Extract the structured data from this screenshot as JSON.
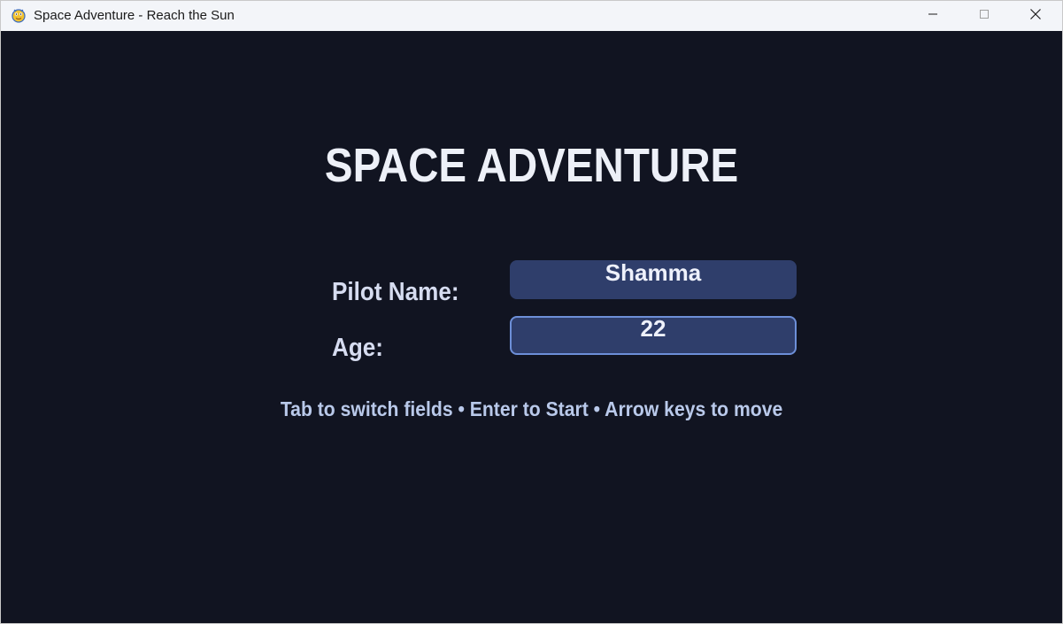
{
  "window": {
    "title": "Space Adventure - Reach the Sun",
    "icon": "pygame-snake-icon",
    "controls": {
      "minimize_icon": "minimize-icon",
      "maximize_icon": "maximize-icon",
      "close_icon": "close-icon"
    }
  },
  "game": {
    "title": "SPACE ADVENTURE",
    "form": {
      "name_label": "Pilot Name:",
      "name_value": "Shamma",
      "age_label": "Age:",
      "age_value": "22",
      "active_field": "age"
    },
    "hint": "Tab to switch fields • Enter to Start • Arrow keys to move"
  },
  "colors": {
    "background": "#111421",
    "field_fill": "#2f3e6b",
    "field_active_border": "#6d8fd8",
    "title_text": "#edf0f8",
    "label_text": "#d6dcf0",
    "hint_text": "#b9c9ea"
  }
}
